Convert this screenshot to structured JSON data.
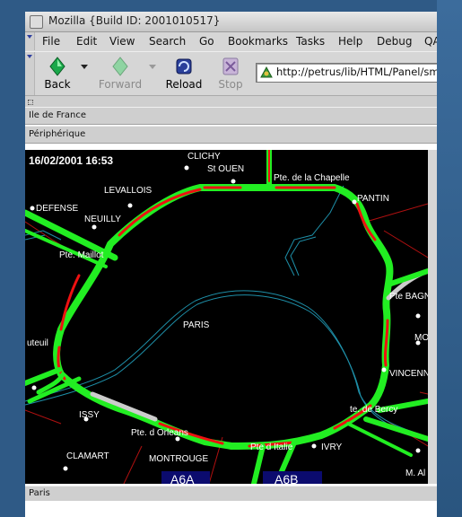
{
  "window": {
    "title": "Mozilla {Build ID: 2001010517}"
  },
  "menu": [
    "File",
    "Edit",
    "View",
    "Search",
    "Go",
    "Bookmarks",
    "Tasks",
    "Help",
    "Debug",
    "QA"
  ],
  "nav": {
    "back": "Back",
    "forward": "Forward",
    "reload": "Reload",
    "stop": "Stop",
    "url": "http://petrus/lib/HTML/Panel/smp/inde"
  },
  "panels": {
    "region": "Ile de France",
    "section": "Périphérique",
    "footer": "Paris"
  },
  "map": {
    "timestamp": "16/02/2001 16:53",
    "labels": [
      "CLICHY",
      "St OUEN",
      "Pte. de la Chapelle",
      "LEVALLOIS",
      "PANTIN",
      "DEFENSE",
      "NEUILLY",
      "Pte. Maillot",
      "Pte BAGN",
      "PARIS",
      "MO",
      "uteuil",
      "VINCENN",
      "te. de Bercy",
      "ISSY",
      "Pte. d Orleans",
      "CLAMART",
      "MONTROUGE",
      "Pte d Italie",
      "IVRY",
      "M. Al",
      "A6A",
      "A6B"
    ]
  },
  "colors": {
    "traffic_fluid": "#22ee22",
    "traffic_jam": "#ee1111",
    "traffic_unknown": "#cccccc",
    "river": "#1e8fa8",
    "road_minor": "#b01010",
    "highway_sign": "#0b0b6e"
  }
}
